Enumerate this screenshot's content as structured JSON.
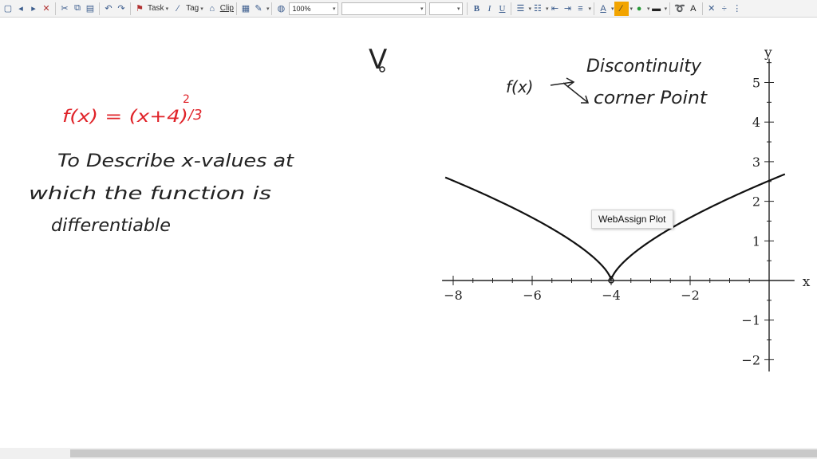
{
  "toolbar": {
    "task_label": "Task",
    "tag_label": "Tag",
    "clip_label": "Clip",
    "zoom_value": "100%",
    "bold_label": "B",
    "italic_label": "I",
    "underline_label": "U",
    "font_size_letter": "A"
  },
  "notes": {
    "function": "f(x) = (x+4)",
    "exponent_num": "2",
    "exponent_den": "/3",
    "task_line1": "To Describe x-values at",
    "task_line2": "which the function is",
    "task_line3": "differentiable",
    "fx_label": "f(x)",
    "discontinuity": "Discontinuity",
    "corner_point": "corner Point",
    "v_mark": "V"
  },
  "plot": {
    "tooltip": "WebAssign Plot"
  },
  "chart_data": {
    "type": "line",
    "function": "(x+4)^(2/3)",
    "x": [
      -8.2,
      -7,
      -6,
      -5,
      -4.5,
      -4,
      -3.5,
      -3,
      -2,
      -1,
      0,
      0.4
    ],
    "y": [
      2.6,
      2.08,
      1.59,
      1.0,
      0.63,
      0,
      0.63,
      1.0,
      1.59,
      2.08,
      2.52,
      2.68
    ],
    "xlabel": "x",
    "ylabel": "y",
    "xlim": [
      -8.2,
      0.4
    ],
    "ylim": [
      -2.3,
      5.6
    ],
    "x_ticks": [
      -8,
      -6,
      -4,
      -2
    ],
    "x_tick_labels": [
      "−8",
      "−6",
      "−4",
      "−2"
    ],
    "y_ticks": [
      -2,
      -1,
      1,
      2,
      3,
      4,
      5
    ],
    "y_tick_labels": [
      "−2",
      "−1",
      "1",
      "2",
      "3",
      "4",
      "5"
    ],
    "grid": false,
    "color": "#111111"
  },
  "colors": {
    "function_ink": "#e0242a",
    "ink": "#222222"
  }
}
